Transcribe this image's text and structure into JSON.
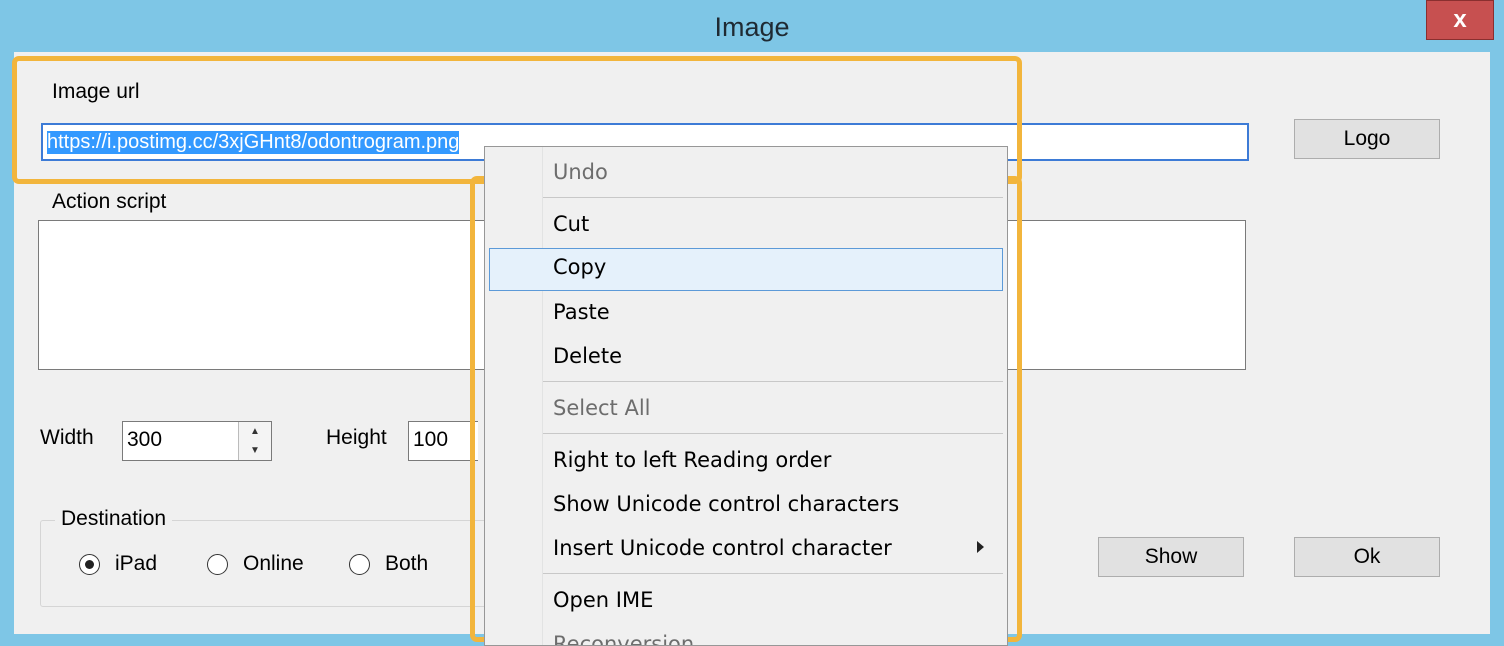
{
  "window": {
    "title": "Image",
    "close_label": "x"
  },
  "form": {
    "image_url_label": "Image url",
    "image_url_value": "https://i.postimg.cc/3xjGHnt8/odontrogram.png",
    "action_script_label": "Action script",
    "action_script_value": "",
    "width_label": "Width",
    "width_value": "300",
    "height_label": "Height",
    "height_value": "100",
    "destination": {
      "label": "Destination",
      "options": [
        {
          "label": "iPad",
          "selected": true
        },
        {
          "label": "Online",
          "selected": false
        },
        {
          "label": "Both",
          "selected": false
        }
      ]
    }
  },
  "buttons": {
    "logo": "Logo",
    "show": "Show",
    "ok": "Ok"
  },
  "context_menu": {
    "items": [
      {
        "label": "Undo",
        "disabled": true
      },
      {
        "label": "Cut"
      },
      {
        "label": "Copy",
        "hover": true
      },
      {
        "label": "Paste"
      },
      {
        "label": "Delete"
      },
      {
        "label": "Select All",
        "disabled": true
      },
      {
        "label": "Right to left Reading order"
      },
      {
        "label": "Show Unicode control characters"
      },
      {
        "label": "Insert Unicode control character",
        "submenu": true
      },
      {
        "label": "Open IME"
      },
      {
        "label": "Reconversion"
      }
    ]
  },
  "colors": {
    "highlight": "#f2b53c",
    "selection": "#3399ff",
    "titlebar": "#7ec6e6",
    "close": "#c75050"
  }
}
